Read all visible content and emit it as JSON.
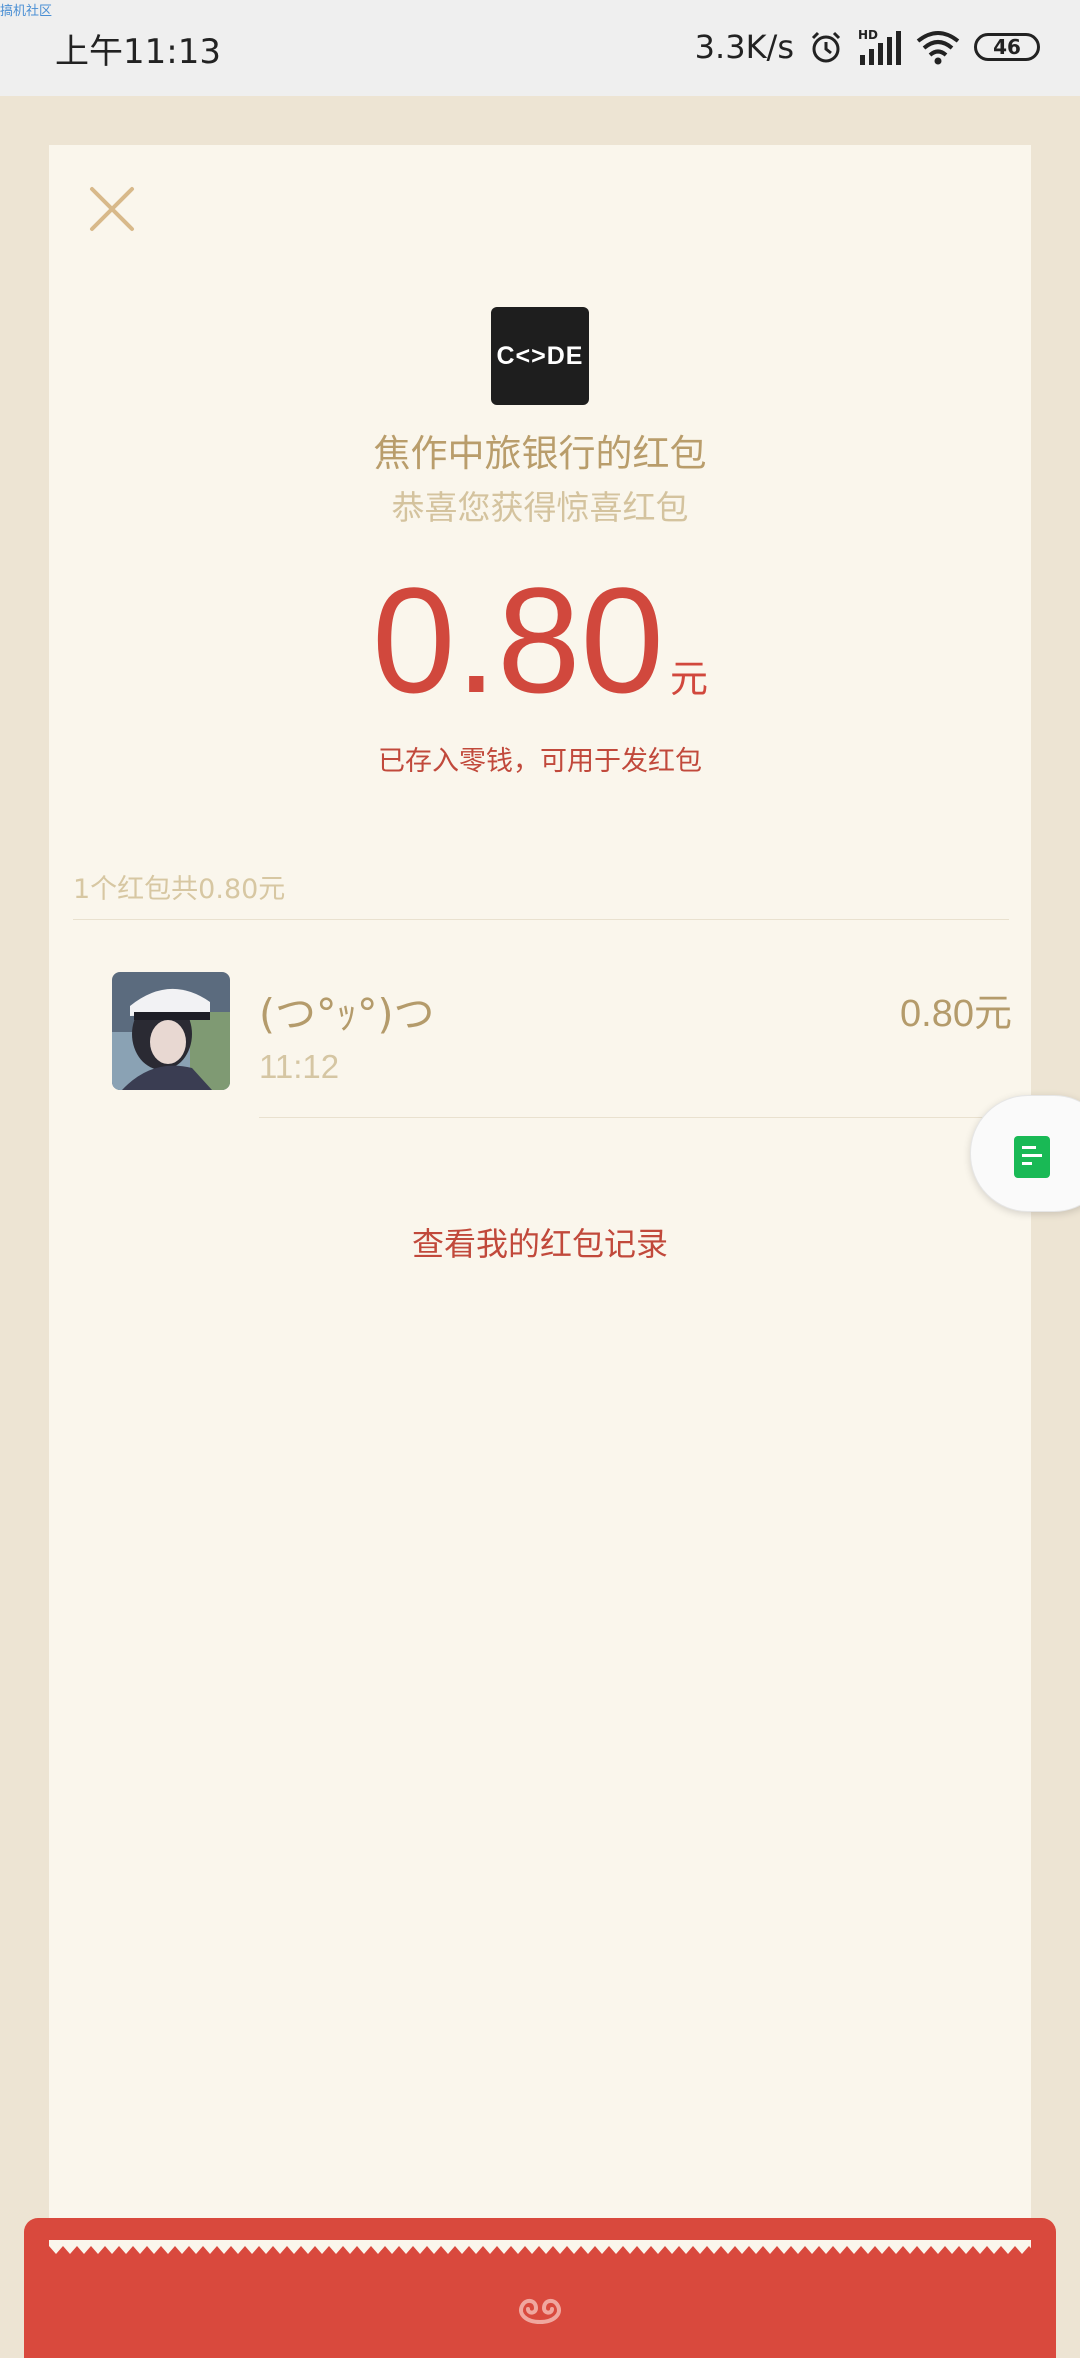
{
  "watermark": "搞机社区",
  "status_bar": {
    "time": "上午11:13",
    "net_speed": "3.3K/s",
    "signal_label": "HD",
    "battery": "46"
  },
  "packet": {
    "sender_title": "焦作中旅银行的红包",
    "subtitle": "恭喜您获得惊喜红包",
    "logo_text": "C<>DE",
    "amount": "0.80",
    "amount_unit": "元",
    "amount_note": "已存入零钱，可用于发红包",
    "summary": "1个红包共0.80元"
  },
  "recipients": [
    {
      "name": "(つ°ｯ°)つ",
      "time": "11:12",
      "amount": "0.80元"
    }
  ],
  "history_link": "查看我的红包记录",
  "colors": {
    "accent_red": "#d1483d",
    "gold_text": "#b99d6b",
    "card_bg": "#faf6ec"
  }
}
